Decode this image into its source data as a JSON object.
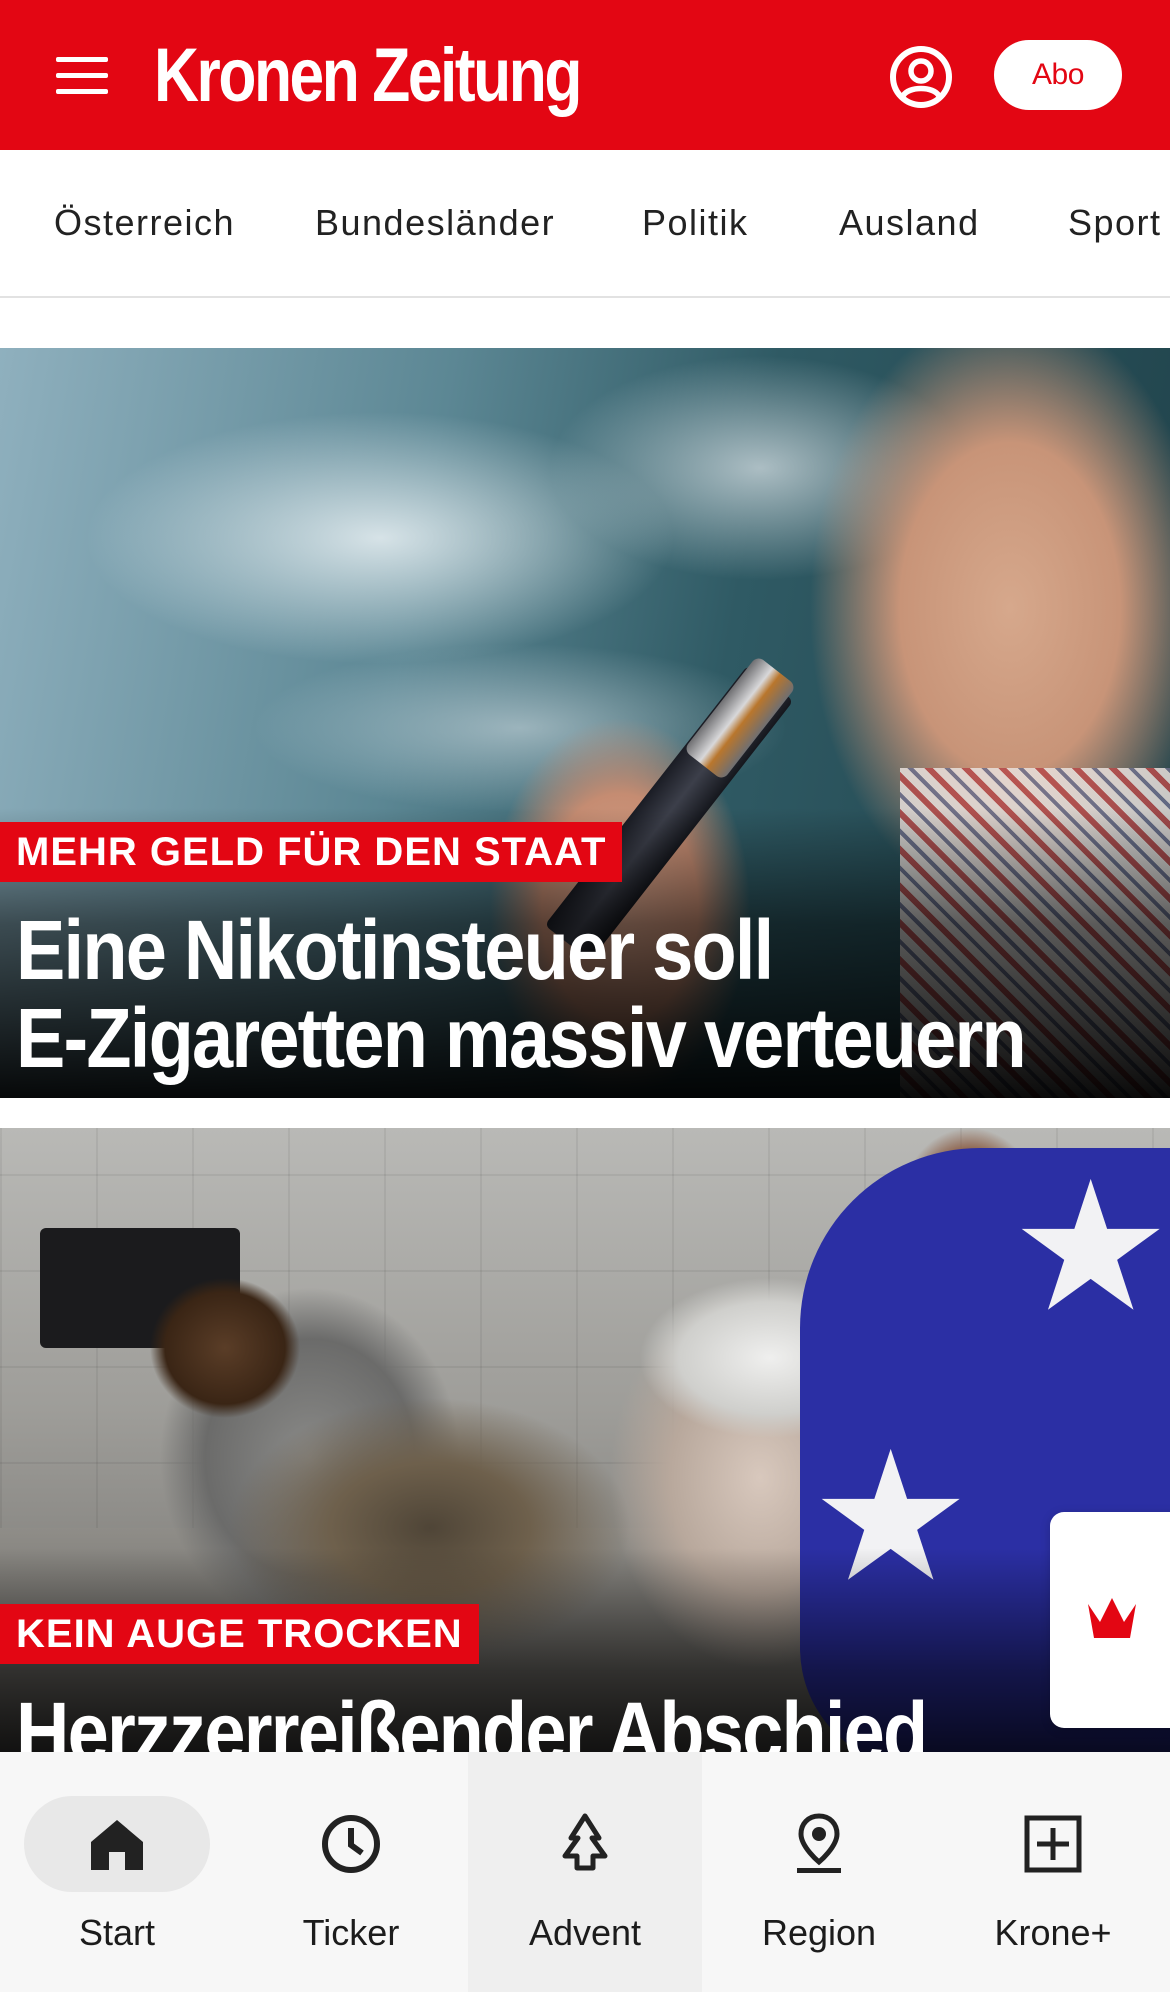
{
  "header": {
    "logo_text": "Kronen Zeitung",
    "abo_label": "Abo",
    "brand_color": "#e30613",
    "menu_icon": "hamburger-icon",
    "account_icon": "user-icon"
  },
  "categories": [
    "Österreich",
    "Bundesländer",
    "Politik",
    "Ausland",
    "Sport"
  ],
  "articles": [
    {
      "kicker": "MEHR GELD FÜR DEN STAAT",
      "headline": "Eine Nikotinsteuer soll\nE-Zigaretten massiv verteuern"
    },
    {
      "kicker": "KEIN AUGE TROCKEN",
      "headline": "Herzzerreißender Abschied"
    }
  ],
  "krone_widget": {
    "icon": "crown-icon"
  },
  "bottom_nav": [
    {
      "label": "Start",
      "icon": "home-icon",
      "active": true
    },
    {
      "label": "Ticker",
      "icon": "clock-icon"
    },
    {
      "label": "Advent",
      "icon": "tree-icon"
    },
    {
      "label": "Region",
      "icon": "location-pin-icon"
    },
    {
      "label": "Krone+",
      "icon": "plus-box-icon"
    }
  ]
}
